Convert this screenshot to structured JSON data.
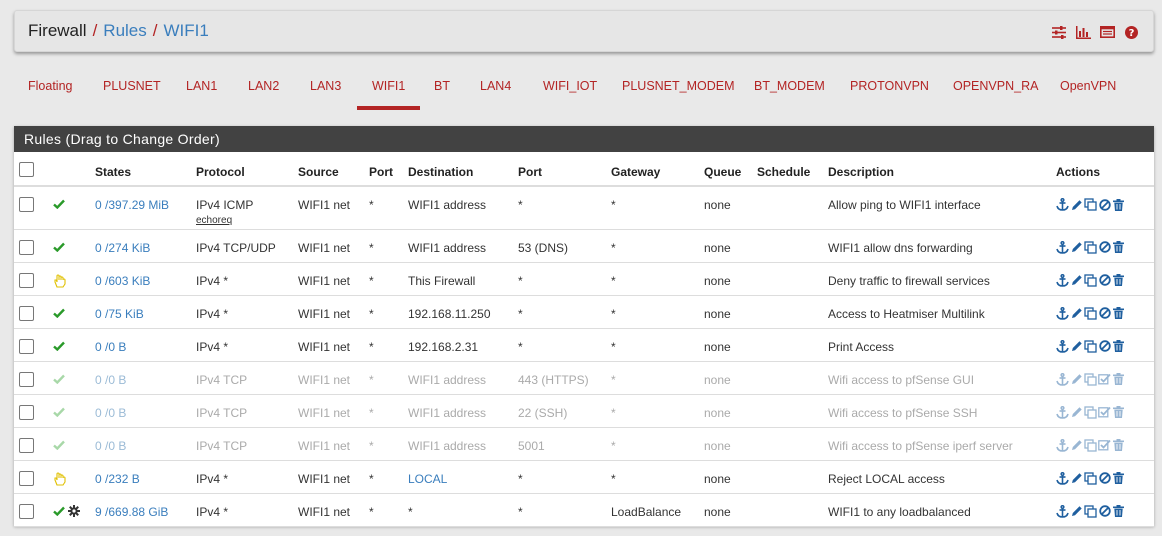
{
  "breadcrumb": {
    "root": "Firewall",
    "sep1": "/",
    "item1": "Rules",
    "sep2": "/",
    "item2": "WIFI1"
  },
  "header_icons": [
    "sliders-icon",
    "chart-icon",
    "table-icon",
    "help-icon"
  ],
  "tabs": [
    {
      "label": "Floating"
    },
    {
      "label": "PLUSNET"
    },
    {
      "label": "LAN1"
    },
    {
      "label": "LAN2"
    },
    {
      "label": "LAN3"
    },
    {
      "label": "WIFI1",
      "active": true
    },
    {
      "label": "BT"
    },
    {
      "label": "LAN4"
    },
    {
      "label": "WIFI_IOT"
    },
    {
      "label": "PLUSNET_MODEM"
    },
    {
      "label": "BT_MODEM"
    },
    {
      "label": "PROTONVPN"
    },
    {
      "label": "OPENVPN_RA"
    },
    {
      "label": "OpenVPN"
    }
  ],
  "panel": {
    "title": "Rules (Drag to Change Order)"
  },
  "columns": {
    "states": "States",
    "protocol": "Protocol",
    "source": "Source",
    "port": "Port",
    "destination": "Destination",
    "dport": "Port",
    "gateway": "Gateway",
    "queue": "Queue",
    "schedule": "Schedule",
    "description": "Description",
    "actions": "Actions"
  },
  "rows": [
    {
      "status": "pass",
      "states": "0 /397.29 MiB",
      "protocol": "IPv4 ICMP",
      "protocol_sub": "echoreq",
      "source": "WIFI1 net",
      "port": "*",
      "destination": "WIFI1 address",
      "dport": "*",
      "gateway": "*",
      "queue": "none",
      "schedule": "",
      "description": "Allow ping to WIFI1 interface",
      "disabled": false
    },
    {
      "status": "pass",
      "states": "0 /274 KiB",
      "protocol": "IPv4 TCP/UDP",
      "source": "WIFI1 net",
      "port": "*",
      "destination": "WIFI1 address",
      "dport": "53 (DNS)",
      "gateway": "*",
      "queue": "none",
      "schedule": "",
      "description": "WIFI1 allow dns forwarding",
      "disabled": false
    },
    {
      "status": "reject",
      "states": "0 /603 KiB",
      "protocol": "IPv4 *",
      "source": "WIFI1 net",
      "port": "*",
      "destination": "This Firewall",
      "dport": "*",
      "gateway": "*",
      "queue": "none",
      "schedule": "",
      "description": "Deny traffic to firewall services",
      "disabled": false
    },
    {
      "status": "pass",
      "states": "0 /75 KiB",
      "protocol": "IPv4 *",
      "source": "WIFI1 net",
      "port": "*",
      "destination": "192.168.11.250",
      "dport": "*",
      "gateway": "*",
      "queue": "none",
      "schedule": "",
      "description": "Access to Heatmiser Multilink",
      "disabled": false
    },
    {
      "status": "pass",
      "states": "0 /0 B",
      "protocol": "IPv4 *",
      "source": "WIFI1 net",
      "port": "*",
      "destination": "192.168.2.31",
      "dport": "*",
      "gateway": "*",
      "queue": "none",
      "schedule": "",
      "description": "Print Access",
      "disabled": false
    },
    {
      "status": "pass",
      "states": "0 /0 B",
      "protocol": "IPv4 TCP",
      "source": "WIFI1 net",
      "port": "*",
      "destination": "WIFI1 address",
      "dport": "443 (HTTPS)",
      "gateway": "*",
      "queue": "none",
      "schedule": "",
      "description": "Wifi access to pfSense GUI",
      "disabled": true
    },
    {
      "status": "pass",
      "states": "0 /0 B",
      "protocol": "IPv4 TCP",
      "source": "WIFI1 net",
      "port": "*",
      "destination": "WIFI1 address",
      "dport": "22 (SSH)",
      "gateway": "*",
      "queue": "none",
      "schedule": "",
      "description": "Wifi access to pfSense SSH",
      "disabled": true
    },
    {
      "status": "pass",
      "states": "0 /0 B",
      "protocol": "IPv4 TCP",
      "source": "WIFI1 net",
      "port": "*",
      "destination": "WIFI1 address",
      "dport": "5001",
      "gateway": "*",
      "queue": "none",
      "schedule": "",
      "description": "Wifi access to pfSense iperf server",
      "disabled": true
    },
    {
      "status": "reject",
      "states": "0 /232 B",
      "protocol": "IPv4 *",
      "source": "WIFI1 net",
      "port": "*",
      "destination": "LOCAL",
      "destination_link": true,
      "dport": "*",
      "gateway": "*",
      "queue": "none",
      "schedule": "",
      "description": "Reject LOCAL access",
      "disabled": false
    },
    {
      "status": "pass",
      "status_extra": "gear",
      "states": "9 /669.88 GiB",
      "protocol": "IPv4 *",
      "source": "WIFI1 net",
      "port": "*",
      "destination": "*",
      "dport": "*",
      "gateway": "LoadBalance",
      "queue": "none",
      "schedule": "",
      "description": "WIFI1 to any loadbalanced",
      "disabled": false
    }
  ],
  "colors": {
    "accent": "#b32424",
    "link": "#3a7ebd",
    "pass": "#2a9a2a",
    "reject": "#e0c000",
    "panel_header": "#424242"
  }
}
